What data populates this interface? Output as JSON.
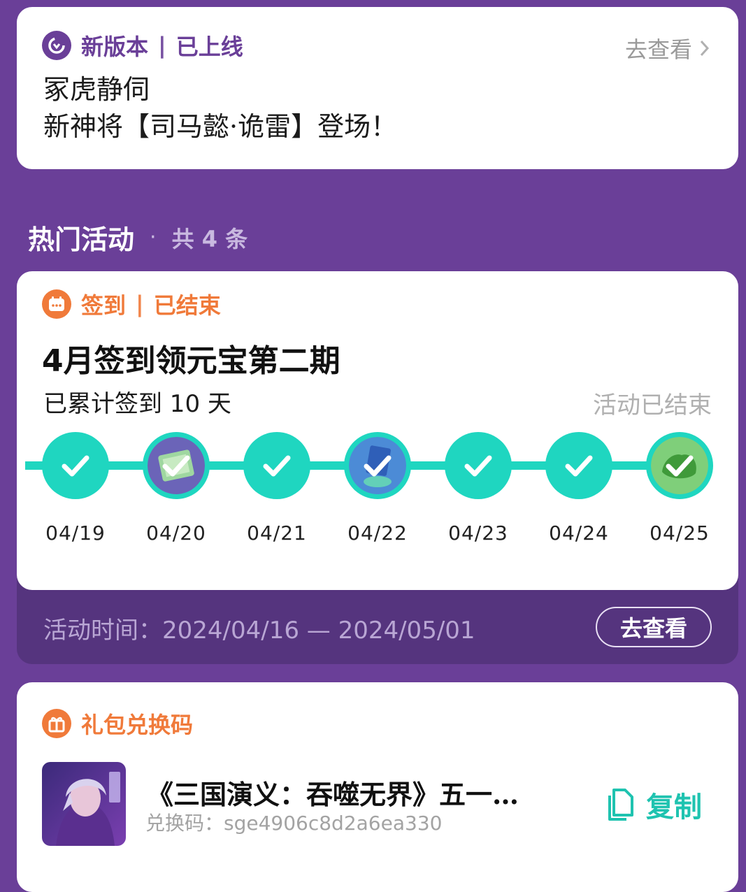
{
  "version": {
    "tag_label": "新版本",
    "tag_sep": "|",
    "tag_status": "已上线",
    "goto_label": "去查看",
    "line1": "冢虎静伺",
    "line2": "新神将【司马懿·诡雷】登场！"
  },
  "section": {
    "title": "热门活动",
    "dot": "·",
    "count_label": "共 4 条"
  },
  "signin": {
    "tag_label": "签到",
    "tag_sep": "|",
    "tag_status": "已结束",
    "title": "4月签到领元宝第二期",
    "days_text": "已累计签到 10 天",
    "ended_label": "活动已结束",
    "days": [
      {
        "date": "04/19",
        "reward": false
      },
      {
        "date": "04/20",
        "reward": true
      },
      {
        "date": "04/21",
        "reward": false
      },
      {
        "date": "04/22",
        "reward": true
      },
      {
        "date": "04/23",
        "reward": false
      },
      {
        "date": "04/24",
        "reward": false
      },
      {
        "date": "04/25",
        "reward": true
      }
    ],
    "time_text": "活动时间：2024/04/16 — 2024/05/01",
    "goto_label": "去查看"
  },
  "gift": {
    "tag_label": "礼包兑换码",
    "name": "《三国演义：吞噬无界》五一…",
    "code_text": "兑换码：sge4906c8d2a6ea330",
    "copy_label": "复制"
  },
  "colors": {
    "background": "#6a3f98",
    "accent_orange": "#f07a3a",
    "accent_teal": "#1fd6c0",
    "footer": "#55347e"
  }
}
